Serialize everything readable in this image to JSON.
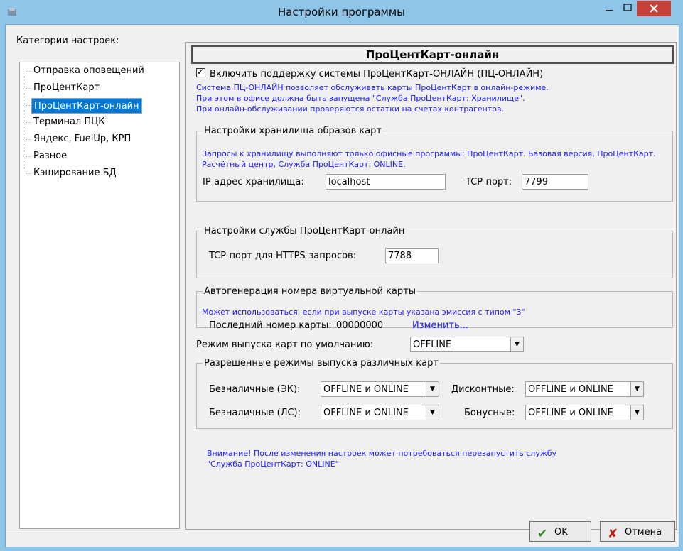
{
  "window": {
    "title": "Настройки программы",
    "icon": "app-icon",
    "controls": {
      "minimize": "–",
      "maximize": "□",
      "close": "✕"
    }
  },
  "left": {
    "label": "Категории настроек:",
    "items": [
      {
        "label": "Отправка оповещений",
        "selected": false
      },
      {
        "label": "ПроЦентКарт",
        "selected": false
      },
      {
        "label": "ПроЦентКарт-онлайн",
        "selected": true
      },
      {
        "label": "Терминал ПЦК",
        "selected": false
      },
      {
        "label": "Яндекс, FuelUp, КРП",
        "selected": false
      },
      {
        "label": "Разное",
        "selected": false
      },
      {
        "label": "Кэширование БД",
        "selected": false
      }
    ]
  },
  "main": {
    "header": "ПроЦентКарт-онлайн",
    "enable_checkbox": {
      "label": "Включить поддержку системы ПроЦентКарт-ОНЛАЙН (ПЦ-ОНЛАЙН)",
      "checked": true
    },
    "info_lines": [
      "Система ПЦ-ОНЛАЙН позволяет обслуживать карты ПроЦентКарт в онлайн-режиме.",
      "При этом в офисе должна быть запущена \"Служба ПроЦентКарт: Хранилище\".",
      "При онлайн-обслуживании проверяются остатки на счетах контрагентов."
    ],
    "storage": {
      "legend": "Настройки хранилища образов карт",
      "note": "Запросы к хранилищу выполняют только офисные программы: ПроЦентКарт. Базовая версия, ПроЦентКарт. Расчётный центр, Служба ПроЦентКарт: ONLINE.",
      "ip_label": "IP-адрес хранилища:",
      "ip_value": "localhost",
      "port_label": "TCP-порт:",
      "port_value": "7799"
    },
    "service": {
      "legend": "Настройки службы ПроЦентКарт-онлайн",
      "port_label": "TCP-порт для HTTPS-запросов:",
      "port_value": "7788"
    },
    "autogen": {
      "legend": "Автогенерация номера виртуальной карты",
      "note": "Может использоваться, если при выпуске карты указана эмиссия с типом \"3\"",
      "last_label": "Последний номер карты:",
      "last_value": "00000000",
      "change_link": "Изменить..."
    },
    "default_mode": {
      "label": "Режим выпуска карт по умолчанию:",
      "value": "OFFLINE"
    },
    "allowed": {
      "legend": "Разрешённые режимы выпуска различных карт",
      "rows": [
        {
          "label": "Безналичные (ЭК):",
          "value": "OFFLINE и ONLINE"
        },
        {
          "label": "Дисконтные:",
          "value": "OFFLINE и ONLINE"
        },
        {
          "label": "Безналичные (ЛС):",
          "value": "OFFLINE и ONLINE"
        },
        {
          "label": "Бонусные:",
          "value": "OFFLINE и ONLINE"
        }
      ]
    },
    "warning_lines": [
      "Внимание! После изменения настроек может потребоваться перезапустить службу",
      "\"Служба ПроЦентКарт: ONLINE\""
    ]
  },
  "footer": {
    "ok": "OK",
    "cancel": "Отмена"
  },
  "colors": {
    "titlebar": "#8fc6e8",
    "close": "#c7413b",
    "selection": "#0078d7",
    "info_text": "#1a1aff"
  }
}
